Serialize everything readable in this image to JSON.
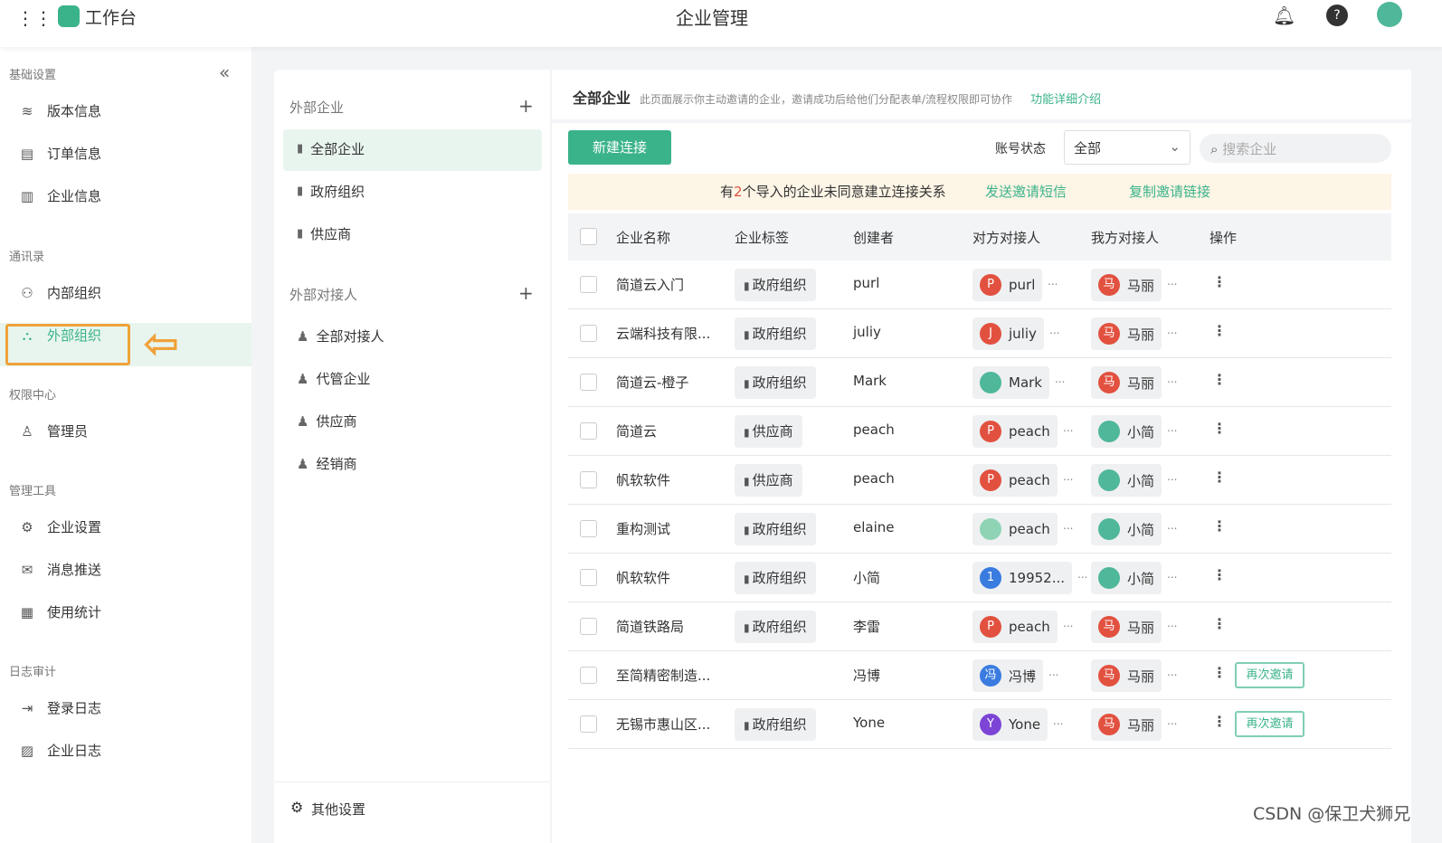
{
  "topbar": {
    "app_title": "工作台",
    "page_title": "企业管理",
    "icons": [
      "grid-icon",
      "bell-icon",
      "help-icon",
      "avatar"
    ]
  },
  "sidebar": {
    "groups": [
      {
        "label": "基础设置",
        "items": [
          {
            "label": "版本信息",
            "icon": "layers-icon"
          },
          {
            "label": "订单信息",
            "icon": "clipboard-icon"
          },
          {
            "label": "企业信息",
            "icon": "building-icon"
          }
        ]
      },
      {
        "label": "通讯录",
        "items": [
          {
            "label": "内部组织",
            "icon": "org-tree-icon"
          },
          {
            "label": "外部组织",
            "icon": "external-org-icon"
          }
        ]
      },
      {
        "label": "权限中心",
        "items": [
          {
            "label": "管理员",
            "icon": "user-icon"
          }
        ]
      },
      {
        "label": "管理工具",
        "items": [
          {
            "label": "企业设置",
            "icon": "gear-icon"
          },
          {
            "label": "消息推送",
            "icon": "mail-icon"
          },
          {
            "label": "使用统计",
            "icon": "calendar-icon"
          }
        ]
      },
      {
        "label": "日志审计",
        "items": [
          {
            "label": "登录日志",
            "icon": "login-icon"
          },
          {
            "label": "企业日志",
            "icon": "log-icon"
          }
        ]
      }
    ],
    "active": "外部组织",
    "collapse_icon": "«"
  },
  "middle": {
    "group1": {
      "label": "外部企业",
      "items": [
        "全部企业",
        "政府组织",
        "供应商"
      ]
    },
    "group2": {
      "label": "外部对接人",
      "items": [
        "全部对接人",
        "代管企业",
        "供应商",
        "经销商"
      ]
    },
    "footer": "其他设置"
  },
  "main": {
    "title": "全部企业",
    "description": "此页面展示你主动邀请的企业，邀请成功后给他们分配表单/流程权限即可协作",
    "help_link": "功能详细介绍",
    "new_button": "新建连接",
    "status_label": "账号状态",
    "status_value": "全部",
    "search_placeholder": "搜索企业",
    "banner": {
      "prefix": "有",
      "count": "2",
      "suffix": "个导入的企业未同意建立连接关系",
      "action1": "发送邀请短信",
      "action2": "复制邀请链接"
    },
    "columns": [
      "企业名称",
      "企业标签",
      "创建者",
      "对方对接人",
      "我方对接人",
      "操作"
    ],
    "rows": [
      {
        "name": "简道云入门",
        "tag": "政府组织",
        "creator": "purl",
        "their": {
          "initial": "P",
          "name": "purl",
          "color": "#e2513f"
        },
        "ours": {
          "initial": "马",
          "name": "马丽",
          "color": "#e2513f"
        }
      },
      {
        "name": "云端科技有限...",
        "tag": "政府组织",
        "creator": "juliy",
        "their": {
          "initial": "J",
          "name": "juliy",
          "color": "#e2513f"
        },
        "ours": {
          "initial": "马",
          "name": "马丽",
          "color": "#e2513f"
        }
      },
      {
        "name": "简道云-橙子",
        "tag": "政府组织",
        "creator": "Mark",
        "their": {
          "initial": "",
          "name": "Mark",
          "color": "#4fb79a"
        },
        "ours": {
          "initial": "马",
          "name": "马丽",
          "color": "#e2513f"
        }
      },
      {
        "name": "简道云",
        "tag": "供应商",
        "creator": "peach",
        "their": {
          "initial": "P",
          "name": "peach",
          "color": "#e2513f"
        },
        "ours": {
          "initial": "",
          "name": "小简",
          "color": "#4fb79a"
        }
      },
      {
        "name": "帆软软件",
        "tag": "供应商",
        "creator": "peach",
        "their": {
          "initial": "P",
          "name": "peach",
          "color": "#e2513f"
        },
        "ours": {
          "initial": "",
          "name": "小简",
          "color": "#4fb79a"
        }
      },
      {
        "name": "重构测试",
        "tag": "政府组织",
        "creator": "elaine",
        "their": {
          "initial": "",
          "name": "peach",
          "color": "#8fd3b5"
        },
        "ours": {
          "initial": "",
          "name": "小简",
          "color": "#4fb79a"
        }
      },
      {
        "name": "帆软软件",
        "tag": "政府组织",
        "creator": "小简",
        "their": {
          "initial": "1",
          "name": "19952...",
          "color": "#3a7be0"
        },
        "ours": {
          "initial": "",
          "name": "小简",
          "color": "#4fb79a"
        }
      },
      {
        "name": "简道铁路局",
        "tag": "政府组织",
        "creator": "李雷",
        "their": {
          "initial": "P",
          "name": "peach",
          "color": "#e2513f"
        },
        "ours": {
          "initial": "马",
          "name": "马丽",
          "color": "#e2513f"
        }
      },
      {
        "name": "至简精密制造...",
        "tag": "",
        "creator": "冯博",
        "their": {
          "initial": "冯",
          "name": "冯博",
          "color": "#3a7be0"
        },
        "ours": {
          "initial": "马",
          "name": "马丽",
          "color": "#e2513f"
        },
        "reinvite": "再次邀请"
      },
      {
        "name": "无锡市惠山区...",
        "tag": "政府组织",
        "creator": "Yone",
        "their": {
          "initial": "Y",
          "name": "Yone",
          "color": "#7c45d6"
        },
        "ours": {
          "initial": "马",
          "name": "马丽",
          "color": "#e2513f"
        },
        "reinvite": "再次邀请"
      }
    ]
  },
  "watermark": "CSDN @保卫犬狮兄",
  "colors": {
    "accent": "#3bb38a",
    "highlight": "#f0a23a",
    "banner_bg": "#fdf5e6"
  }
}
